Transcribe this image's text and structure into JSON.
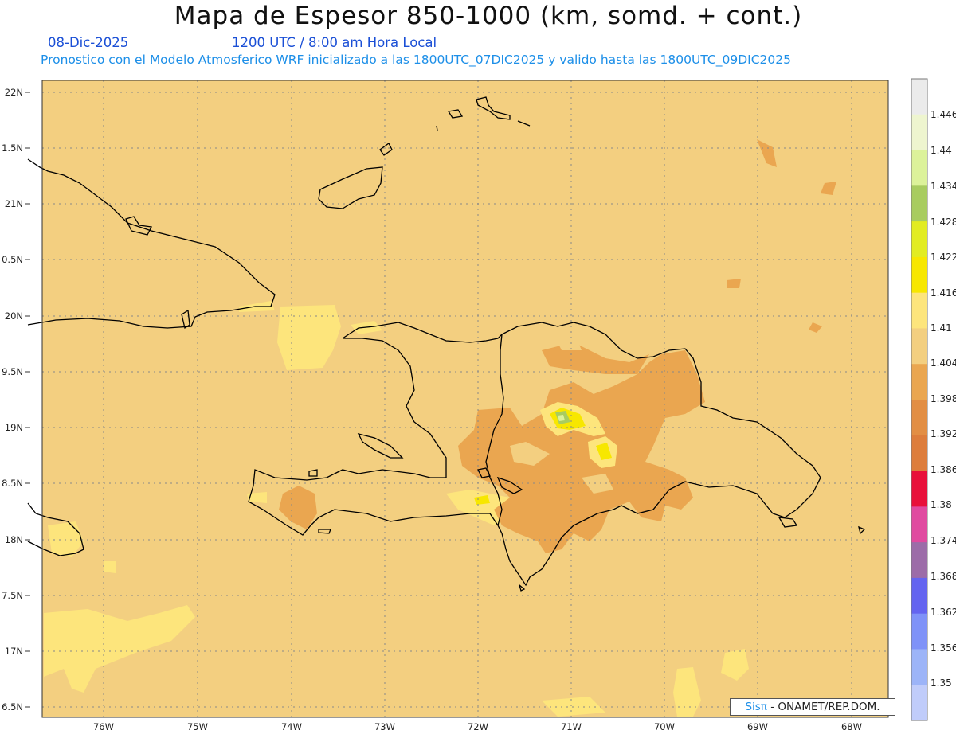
{
  "header": {
    "title": "Mapa de Espesor 850-1000 (km, somd. + cont.)",
    "date": "08-Dic-2025",
    "time": "1200 UTC / 8:00 am Hora Local",
    "description": "Pronostico con el Modelo Atmosferico WRF inicializado a las 1800UTC_07DIC2025 y valido hasta las  1800UTC_09DIC2025"
  },
  "axes": {
    "lat_labels": [
      "22N",
      "1.5N",
      "21N",
      "0.5N",
      "20N",
      "9.5N",
      "19N",
      "8.5N",
      "18N",
      "7.5N",
      "17N",
      "6.5N"
    ],
    "lon_labels": [
      "76W",
      "75W",
      "74W",
      "73W",
      "72W",
      "71W",
      "70W",
      "69W",
      "68W"
    ]
  },
  "colorbar": {
    "labels": [
      "1.446",
      "1.44",
      "1.434",
      "1.428",
      "1.422",
      "1.416",
      "1.41",
      "1.404",
      "1.398",
      "1.392",
      "1.386",
      "1.38",
      "1.374",
      "1.368",
      "1.362",
      "1.356",
      "1.35"
    ],
    "colors": [
      "#ebebeb",
      "#eef5cf",
      "#dcf29a",
      "#a8cc60",
      "#e2ec22",
      "#f7e700",
      "#fde57c",
      "#f3cf80",
      "#eaa650",
      "#e28e44",
      "#dd7d3c",
      "#e8103a",
      "#e04aa0",
      "#9c6ca8",
      "#6464f0",
      "#7f92f8",
      "#9cb4f8",
      "#c0ccfa"
    ]
  },
  "credit": {
    "brand": "Sisπ",
    "text": " - ONAMET/REP.DOM."
  }
}
